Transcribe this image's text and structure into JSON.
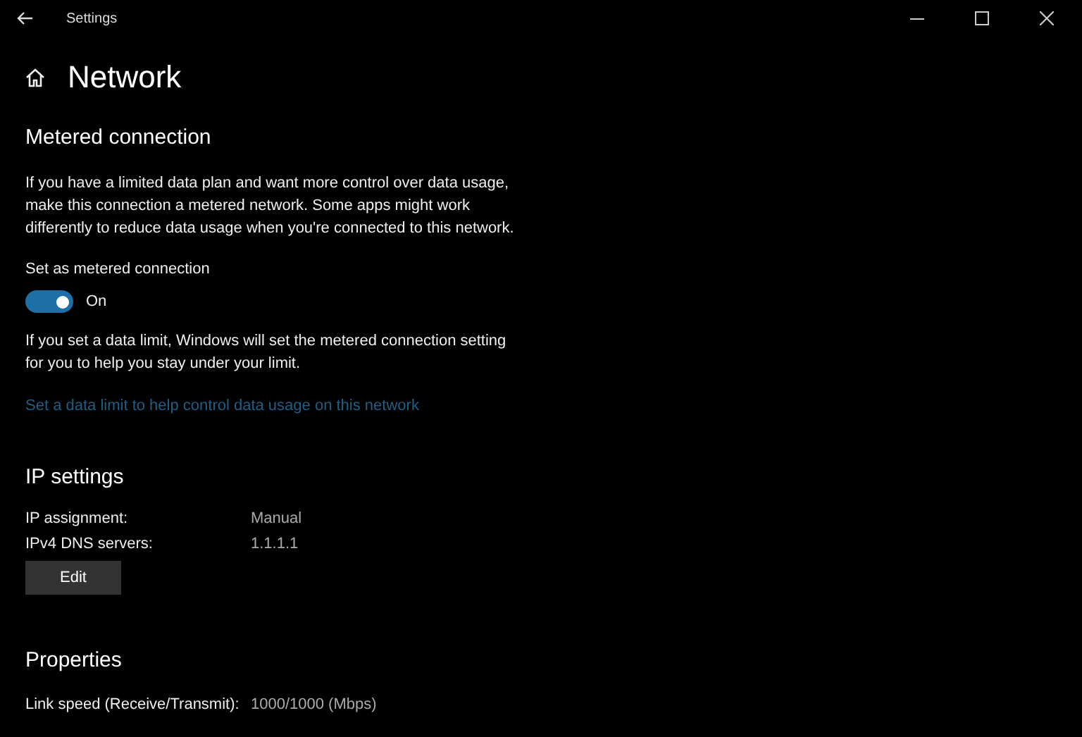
{
  "window": {
    "title": "Settings"
  },
  "page": {
    "title": "Network"
  },
  "metered": {
    "heading": "Metered connection",
    "description": "If you have a limited data plan and want more control over data usage, make this connection a metered network. Some apps might work differently to reduce data usage when you're connected to this network.",
    "toggle": {
      "label": "Set as metered connection",
      "on": true,
      "state_text": "On"
    },
    "note": "If you set a data limit, Windows will set the metered connection setting for you to help you stay under your limit.",
    "link": "Set a data limit to help control data usage on this network"
  },
  "ip_settings": {
    "heading": "IP settings",
    "rows": [
      {
        "label": "IP assignment:",
        "value": "Manual"
      },
      {
        "label": "IPv4 DNS servers:",
        "value": "1.1.1.1"
      }
    ],
    "button": "Edit"
  },
  "properties": {
    "heading": "Properties",
    "rows": [
      {
        "label": "Link speed (Receive/Transmit):",
        "value": "1000/1000 (Mbps)"
      }
    ]
  }
}
